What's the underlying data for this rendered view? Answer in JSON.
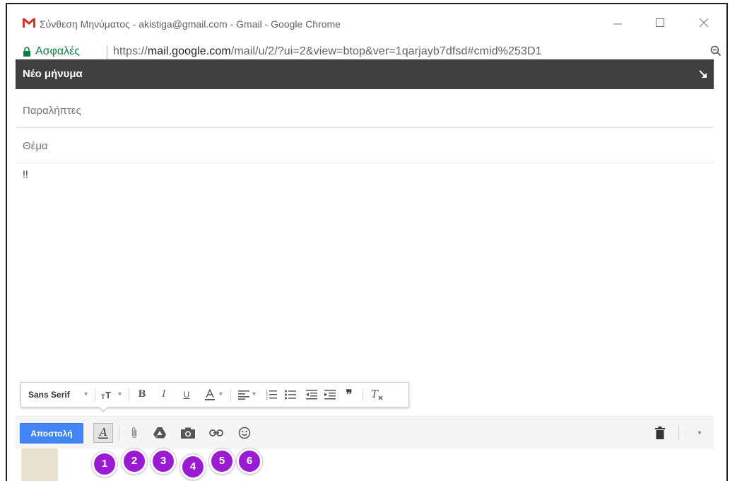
{
  "window": {
    "title": "Σύνθεση Μηνύματος - akistiga@gmail.com - Gmail - Google Chrome",
    "minimize": "—",
    "maximize": "☐",
    "close": "✕"
  },
  "address_bar": {
    "secure_label": "Ασφαλές",
    "url_prefix": "https://",
    "url_host": "mail.google.com",
    "url_path": "/mail/u/2/?ui=2&view=btop&ver=1qarjayb7dfsd#cmid%253D1"
  },
  "compose": {
    "title": "Νέο μήνυμα",
    "recipients_placeholder": "Παραλήπτες",
    "subject_placeholder": "Θέμα",
    "body": "!!"
  },
  "format_toolbar": {
    "font": "Sans Serif",
    "font_caret": "▾",
    "size_caret": "▾",
    "bold": "B",
    "italic": "I",
    "underline": "U",
    "color_caret": "▾",
    "align_caret": "▾",
    "quote": "❞"
  },
  "action_bar": {
    "send_label": "Αποστολή",
    "more_caret": "▾"
  },
  "markers": [
    "1",
    "2",
    "3",
    "4",
    "5",
    "6"
  ],
  "colors": {
    "compose_header": "#404040",
    "send_button": "#4285f4",
    "marker": "#9b1bd3",
    "secure_green": "#0b8043",
    "gmail_red": "#d93025"
  }
}
